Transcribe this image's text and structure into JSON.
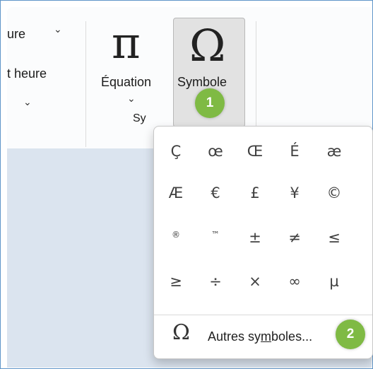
{
  "ribbon": {
    "partial_item_1": "ure",
    "partial_item_2": "t heure",
    "equation_label": "Équation",
    "symbole_label": "Symbole",
    "group_label_partial": "Sy"
  },
  "icons": {
    "pi": "π",
    "omega": "Ω",
    "chevron": "⌄"
  },
  "badges": {
    "step1": "1",
    "step2": "2"
  },
  "symbols": [
    "Ç",
    "œ",
    "Œ",
    "É",
    "æ",
    "Æ",
    "€",
    "£",
    "¥",
    "©",
    "®",
    "™",
    "±",
    "≠",
    "≤",
    "≥",
    "÷",
    "×",
    "∞",
    "µ"
  ],
  "more": {
    "label_before": "Autres sy",
    "label_underlined": "m",
    "label_after": "boles..."
  },
  "colors": {
    "badge_green": "#7fba44",
    "workspace_blue": "#dbe4ef",
    "selected_bg": "#e2e2e2"
  }
}
